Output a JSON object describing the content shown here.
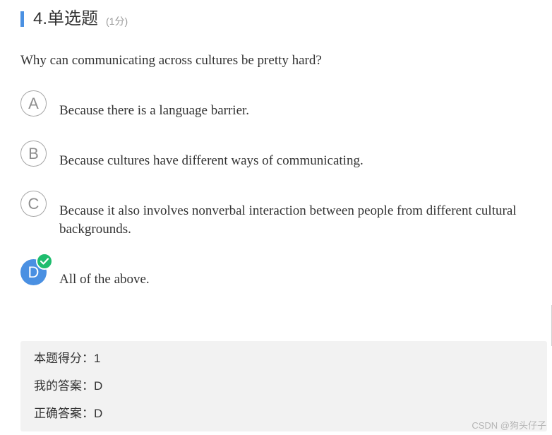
{
  "question": {
    "title": "4.单选题",
    "score": "(1分)",
    "text": "Why can communicating across cultures be pretty hard?"
  },
  "options": [
    {
      "letter": "A",
      "text": "Because there is a language barrier.",
      "selected": false
    },
    {
      "letter": "B",
      "text": "Because cultures have different ways of communicating.",
      "selected": false
    },
    {
      "letter": "C",
      "text": "Because it also involves nonverbal interaction between people from different cultural backgrounds.",
      "selected": false
    },
    {
      "letter": "D",
      "text": "All of the above.",
      "selected": true,
      "status_icon": "check-circle-icon"
    }
  ],
  "result": {
    "score_line": "本题得分：1",
    "my_answer_line": "我的答案：D",
    "correct_answer_line": "正确答案：D"
  },
  "watermark": "CSDN @狗头仔子",
  "colors": {
    "accent": "#4a90e2",
    "correct": "#1ebd6e",
    "result_bg": "#f2f2f2"
  }
}
